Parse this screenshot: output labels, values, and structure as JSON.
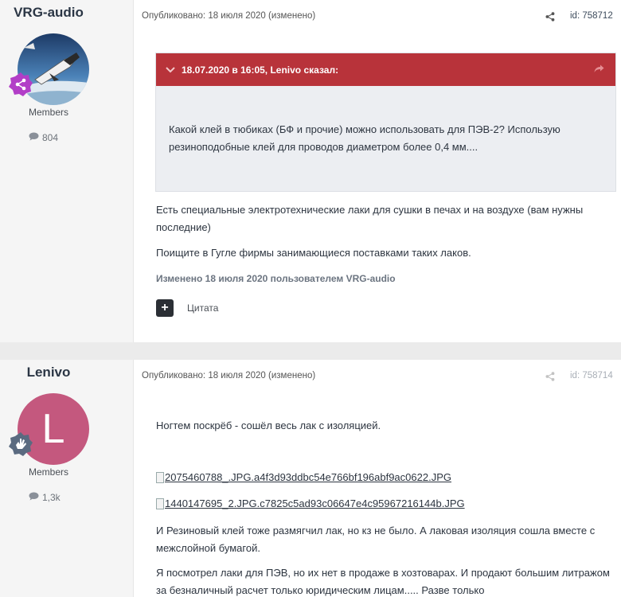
{
  "posts": [
    {
      "author": "VRG-audio",
      "group": "Members",
      "count": "804",
      "meta": "Опубликовано: 18 июля 2020 (изменено)",
      "id": "id: 758712",
      "quote": {
        "header": "18.07.2020 в 16:05, Lenivo сказал:",
        "text": "Какой клей в тюбиках (БФ и прочие) можно использовать для ПЭВ-2? Использую резиноподобные клей для проводов диаметром более 0,4 мм...."
      },
      "paragraphs": [
        "Есть специальные электротехнические лаки  для сушки в печах и на воздухе (вам нужны последние)",
        "Поищите в Гугле фирмы занимающиеся поставками таких лаков."
      ],
      "edited": "Изменено 18 июля 2020 пользователем VRG-audio",
      "plus": "+",
      "quote_label": "Цитата"
    },
    {
      "author": "Lenivo",
      "avatar_letter": "L",
      "group": "Members",
      "count": "1,3k",
      "meta": "Опубликовано: 18 июля 2020 (изменено)",
      "id": "id: 758714",
      "paragraphs": [
        "Ногтем поскрёб - сошёл весь лак с изоляцией.",
        "И Резиновый клей тоже размягчил лак, но кз не было. А лаковая изоляция сошла вместе с межслойной  бумагой.",
        "Я посмотрел лаки для ПЭВ, но их нет в продаже в хозтоварах. И продают большим литражом за безналичный расчет только юридическим лицам..... Разве только"
      ],
      "images": [
        "2075460788_.JPG.a4f3d93ddbc54e766bf196abf9ac0622.JPG",
        "1440147695_2.JPG.c7825c5ad93c06647e4c95967216144b.JPG"
      ]
    }
  ],
  "colors": {
    "quote_header": "#b8333a",
    "avatar_lenivo": "#c4587e",
    "badge_purple": "#b23ec7"
  }
}
